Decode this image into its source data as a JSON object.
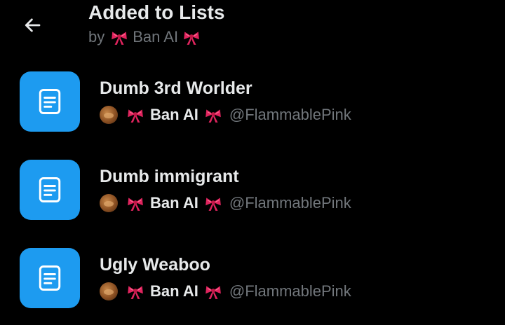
{
  "theme": {
    "background": "#000000",
    "text_primary": "#e7e9ea",
    "text_secondary": "#71767b",
    "list_icon_bg": "#1d9bf0"
  },
  "header": {
    "back_icon": "arrow-left-icon",
    "title": "Added to Lists",
    "by_label": "by",
    "user_name": "Ban AI"
  },
  "lists": [
    {
      "name": "Dumb 3rd Worlder",
      "owner_name": "Ban AI",
      "owner_handle": "@FlammablePink",
      "icon": "list-document-icon"
    },
    {
      "name": "Dumb immigrant",
      "owner_name": "Ban AI",
      "owner_handle": "@FlammablePink",
      "icon": "list-document-icon"
    },
    {
      "name": "Ugly Weaboo",
      "owner_name": "Ban AI",
      "owner_handle": "@FlammablePink",
      "icon": "list-document-icon"
    }
  ]
}
